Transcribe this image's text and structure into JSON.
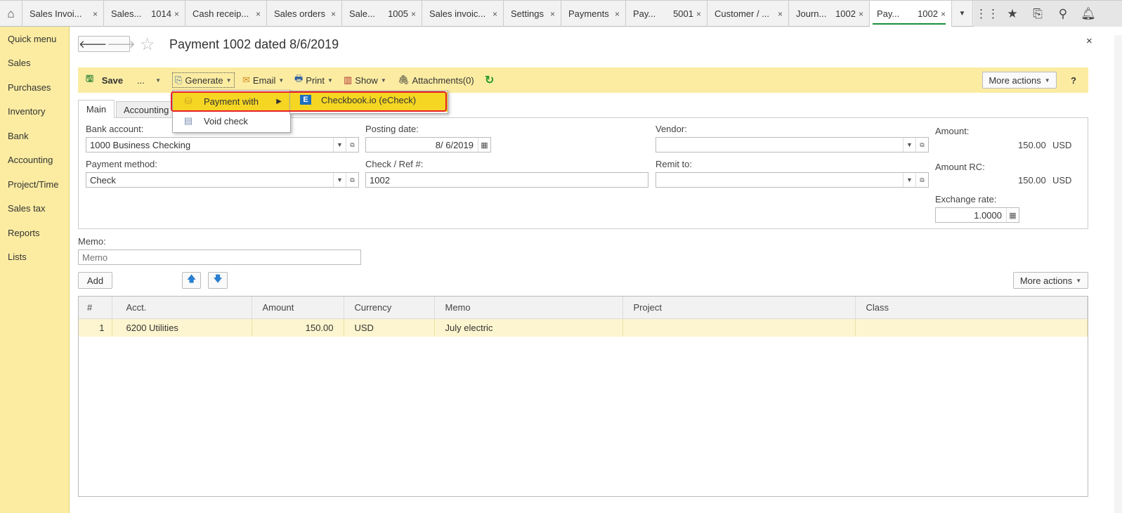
{
  "tabs": [
    {
      "title": "Sales Invoi...",
      "num": ""
    },
    {
      "title": "Sales...",
      "num": "1014"
    },
    {
      "title": "Cash receip...",
      "num": ""
    },
    {
      "title": "Sales orders",
      "num": ""
    },
    {
      "title": "Sale...",
      "num": "1005"
    },
    {
      "title": "Sales invoic...",
      "num": ""
    },
    {
      "title": "Settings",
      "num": ""
    },
    {
      "title": "Payments",
      "num": ""
    },
    {
      "title": "Pay...",
      "num": "5001"
    },
    {
      "title": "Customer / ...",
      "num": ""
    },
    {
      "title": "Journ...",
      "num": "1002"
    },
    {
      "title": "Pay...",
      "num": "1002"
    }
  ],
  "tab_close": "×",
  "sidebar": [
    "Quick menu",
    "Sales",
    "Purchases",
    "Inventory",
    "Bank",
    "Accounting",
    "Project/Time",
    "Sales tax",
    "Reports",
    "Lists"
  ],
  "header": {
    "title": "Payment 1002 dated 8/6/2019",
    "close": "×"
  },
  "toolbar": {
    "save": "Save",
    "more": "...",
    "generate": "Generate",
    "email": "Email",
    "print": "Print",
    "show": "Show",
    "attachments": "Attachments(0)",
    "more_actions": "More actions",
    "help": "?"
  },
  "generate_menu": {
    "payment_with": "Payment with",
    "void_check": "Void check",
    "submenu_item": "Checkbook.io (eCheck)"
  },
  "form_tabs": [
    "Main",
    "Accounting"
  ],
  "form": {
    "bank_account_label": "Bank account:",
    "bank_account": "1000 Business Checking",
    "payment_method_label": "Payment method:",
    "payment_method": "Check",
    "posting_date_label": "Posting date:",
    "posting_date": "8/ 6/2019",
    "check_ref_label": "Check / Ref #:",
    "check_ref": "1002",
    "vendor_label": "Vendor:",
    "vendor": "",
    "remit_to_label": "Remit to:",
    "remit_to": "",
    "amount_label": "Amount:",
    "amount": "150.00",
    "amount_currency": "USD",
    "amount_rc_label": "Amount RC:",
    "amount_rc": "150.00",
    "amount_rc_currency": "USD",
    "exchange_rate_label": "Exchange rate:",
    "exchange_rate": "1.0000",
    "memo_label": "Memo:",
    "memo_placeholder": "Memo"
  },
  "lines": {
    "add": "Add",
    "more_actions": "More actions",
    "columns": [
      "#",
      "Acct.",
      "Amount",
      "Currency",
      "Memo",
      "Project",
      "Class"
    ],
    "rows": [
      {
        "n": "1",
        "acct": "6200 Utilities",
        "amount": "150.00",
        "currency": "USD",
        "memo": "July electric",
        "project": "",
        "class": ""
      }
    ]
  }
}
